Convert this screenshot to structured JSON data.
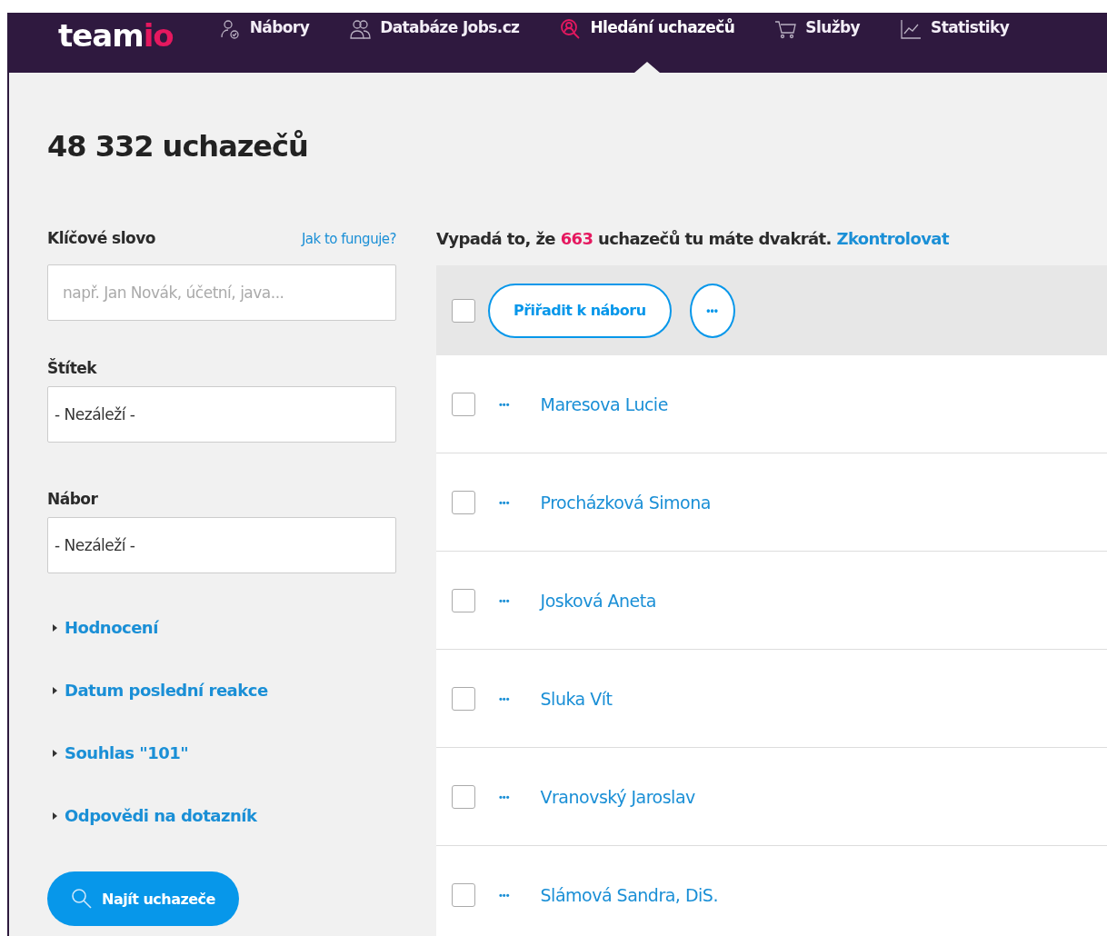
{
  "nav": {
    "logo": {
      "main": "team",
      "accent": "io"
    },
    "items": [
      {
        "label": "Nábory",
        "selected": false
      },
      {
        "label": "Databáze Jobs.cz",
        "selected": false
      },
      {
        "label": "Hledání uchazečů",
        "selected": true
      },
      {
        "label": "Služby",
        "selected": false
      },
      {
        "label": "Statistiky",
        "selected": false
      }
    ]
  },
  "title": "48 332 uchazečů",
  "filters": {
    "keyword": {
      "label": "Klíčové slovo",
      "help": "Jak to funguje?",
      "placeholder": "např. Jan Novák, účetní, java..."
    },
    "selects": [
      {
        "label": "Štítek",
        "value": "- Nezáleží -"
      },
      {
        "label": "Nábor",
        "value": "- Nezáleží -"
      }
    ],
    "sections": [
      {
        "label": "Hodnocení",
        "expanded": false
      },
      {
        "label": "Datum poslední reakce",
        "expanded": false
      },
      {
        "label": "Souhlas \"101\"",
        "expanded": false
      },
      {
        "label": "Odpovědi na dotazník",
        "expanded": false
      }
    ],
    "submit": "Najít uchazeče"
  },
  "notice": {
    "before": "Vypadá to, že",
    "count": "663",
    "after": "uchazečů tu máte dvakrát.",
    "link": "Zkontrolovat"
  },
  "toolbar": {
    "checked": false,
    "assign": "Přiřadit k náboru",
    "more": "•••"
  },
  "rows": [
    {
      "name": "Maresova Lucie",
      "checked": false,
      "more": "•••"
    },
    {
      "name": "Procházková Simona",
      "checked": false,
      "more": "•••"
    },
    {
      "name": "Josková Aneta",
      "checked": false,
      "more": "•••"
    },
    {
      "name": "Sluka Vít",
      "checked": false,
      "more": "•••"
    },
    {
      "name": "Vranovský Jaroslav",
      "checked": false,
      "more": "•••"
    },
    {
      "name": "Slámová Sandra, DiS.",
      "checked": false,
      "more": "•••"
    }
  ]
}
